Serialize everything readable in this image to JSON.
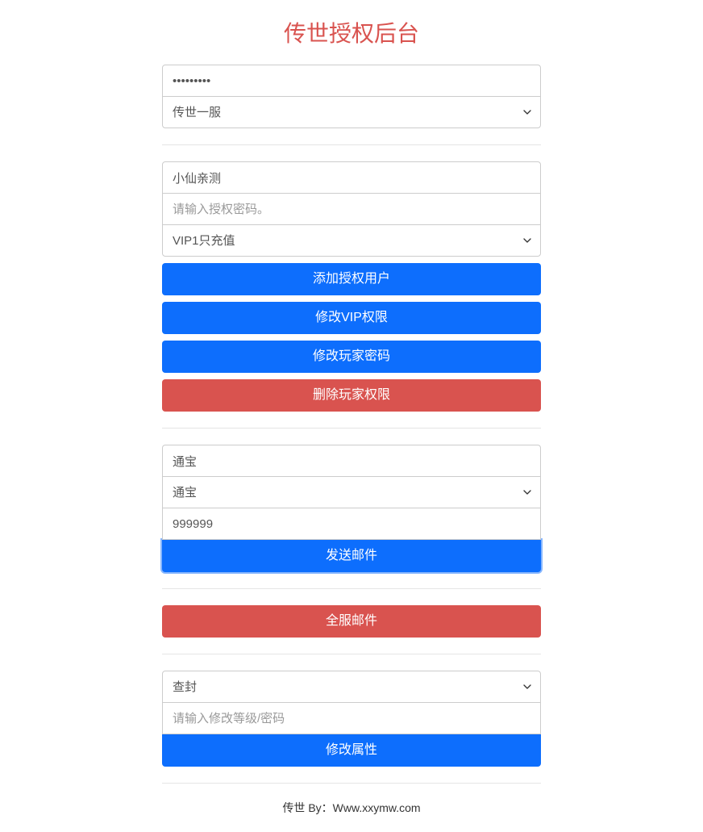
{
  "title": "传世授权后台",
  "section1": {
    "password_value": "•••••••••",
    "server_select": "传世一服"
  },
  "section2": {
    "username_value": "小仙亲测",
    "auth_password_placeholder": "请输入授权密码。",
    "vip_select": "VIP1只充值",
    "btn_add_user": "添加授权用户",
    "btn_modify_vip": "修改VIP权限",
    "btn_modify_password": "修改玩家密码",
    "btn_delete_permission": "删除玩家权限"
  },
  "section3": {
    "item_input": "通宝",
    "item_select": "通宝",
    "amount_value": "999999",
    "btn_send_mail": "发送邮件"
  },
  "section4": {
    "btn_global_mail": "全服邮件"
  },
  "section5": {
    "action_select": "查封",
    "modify_placeholder": "请输入修改等级/密码",
    "btn_modify_attr": "修改属性"
  },
  "footer": "传世 By：Www.xxymw.com"
}
